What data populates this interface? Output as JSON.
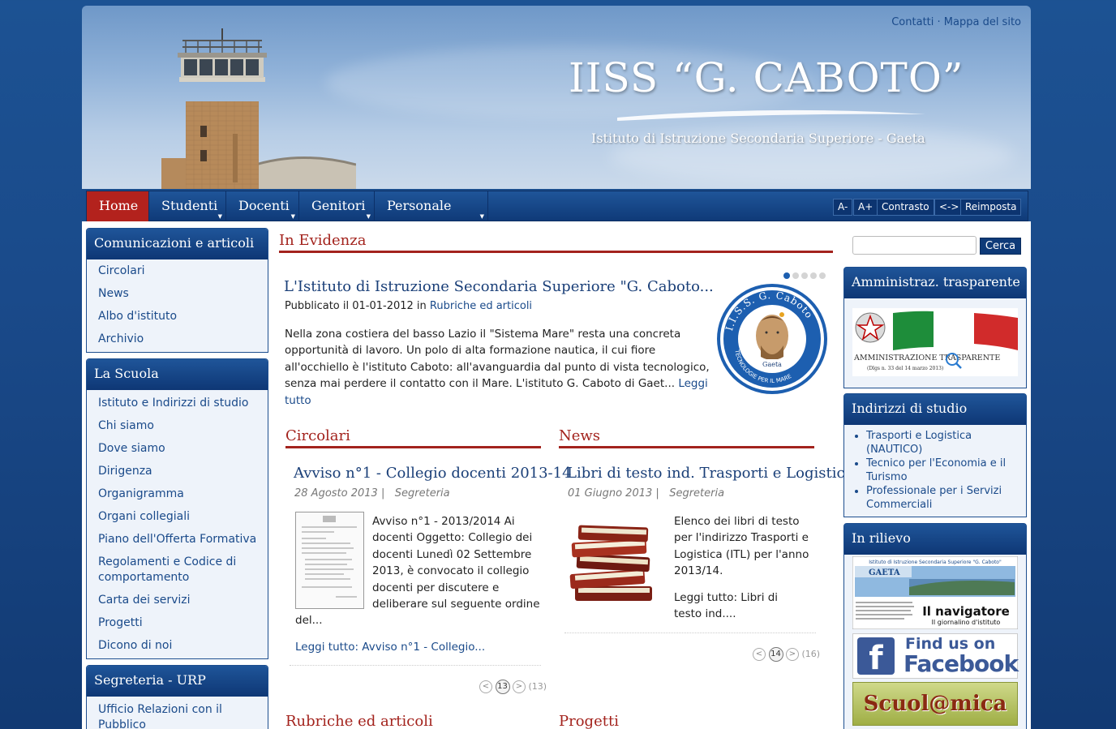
{
  "header": {
    "top_links": [
      "Contatti",
      "Mappa del sito"
    ],
    "title": "IISS “G. CABOTO”",
    "subtitle": "Istituto di Istruzione Secondaria Superiore - Gaeta"
  },
  "nav": {
    "items": [
      {
        "label": "Home"
      },
      {
        "label": "Studenti"
      },
      {
        "label": "Docenti"
      },
      {
        "label": "Genitori"
      },
      {
        "label": "Personale ATA"
      }
    ],
    "accessibility": [
      "A-",
      "A+",
      "Contrasto",
      "<->",
      "Reimposta"
    ]
  },
  "left_sidebar": {
    "box1": {
      "title": "Comunicazioni e articoli",
      "items": [
        "Circolari",
        "News",
        "Albo d'istituto",
        "Archivio"
      ]
    },
    "box2": {
      "title": "La Scuola",
      "items": [
        "Istituto e Indirizzi di studio",
        "Chi siamo",
        "Dove siamo",
        "Dirigenza",
        "Organigramma",
        "Organi collegiali",
        "Piano dell'Offerta Formativa",
        "Regolamenti e Codice di comportamento",
        "Carta dei servizi",
        "Progetti",
        "Dicono di noi"
      ]
    },
    "box3": {
      "title": "Segreteria - URP",
      "items": [
        "Ufficio Relazioni con il Pubblico"
      ]
    }
  },
  "featured": {
    "section_title": "In Evidenza",
    "title": "L'Istituto di Istruzione Secondaria Superiore \"G. Caboto...",
    "meta_prefix": "Pubblicato il 01-01-2012 in",
    "meta_category": "Rubriche ed articoli",
    "body": "Nella zona costiera del basso Lazio il \"Sistema Mare\" resta una concreta opportunità di lavoro. Un polo di alta formazione nautica, il cui fiore all'occhiello è l'istituto Caboto: all'avanguardia dal punto di vista tecnologico, senza mai perdere il contatto con il Mare. L'istituto G. Caboto di Gaet...",
    "read_more": "Leggi tutto",
    "logo": {
      "ring_text": "I.I.S.S. G. Caboto",
      "bottom_text": "Gaeta",
      "left_text": "TECNOLOGIE",
      "right_text": "PER IL MARE"
    }
  },
  "circolari": {
    "section_title": "Circolari",
    "title": "Avviso n°1 - Collegio docenti 2013-14",
    "date": "28 Agosto 2013",
    "category": "Segreteria",
    "body": "Avviso n°1 - 2013/2014 Ai docenti Oggetto: Collegio dei docenti Lunedì  02 Settembre 2013, è convocato il collegio docenti per discutere e deliberare sul seguente ordine del...",
    "read_more": "Leggi tutto: Avviso n°1 - Collegio...",
    "pager": {
      "prev": "<",
      "current": "13",
      "next": ">",
      "total": "(13)"
    }
  },
  "news": {
    "section_title": "News",
    "title": "Libri di testo ind. Trasporti e Logistica",
    "date": "01 Giugno 2013",
    "category": "Segreteria",
    "body": "Elenco dei libri di testo per l'indirizzo Trasporti e Logistica (ITL) per l'anno 2013/14.",
    "read_more": "Leggi tutto: Libri di testo ind....",
    "pager": {
      "prev": "<",
      "current": "14",
      "next": ">",
      "total": "(16)"
    }
  },
  "bottom_sections": [
    "Rubriche ed articoli",
    "Progetti"
  ],
  "right_sidebar": {
    "search_button": "Cerca",
    "search_placeholder": "",
    "box1": {
      "title": "Amministraz. trasparente",
      "banner_text": "AMMINISTRAZIONE TRASPARENTE",
      "banner_sub": "(Dlgs n. 33 del 14 marzo 2013)"
    },
    "box2": {
      "title": "Indirizzi di studio",
      "items": [
        "Trasporti e Logistica (NAUTICO)",
        "Tecnico per l'Economia e il Turismo",
        "Professionale per i Servizi Commerciali"
      ]
    },
    "box3": {
      "title": "In rilievo",
      "navigatore": {
        "header": "Istituto di Istruzione Secondaria Superiore \"G. Caboto\"",
        "city": "GAETA",
        "name": "Il navigatore",
        "sub": "Il giornalino d'istituto"
      },
      "facebook": {
        "line1": "Find us on",
        "line2": "Facebook"
      },
      "scuolamica": "Scuol@mica"
    }
  },
  "colors": {
    "brand_blue": "#1d4e8f",
    "accent_red": "#a3231d",
    "active_nav": "#b3221d"
  }
}
